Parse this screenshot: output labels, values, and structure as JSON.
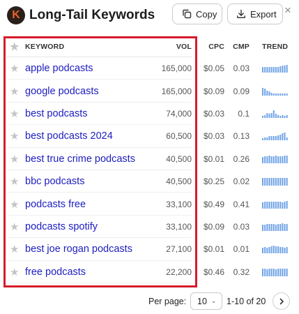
{
  "header": {
    "logo_letter": "K",
    "title": "Long-Tail Keywords",
    "copy_label": "Copy",
    "export_label": "Export",
    "close_glyph": "×"
  },
  "table": {
    "columns": {
      "keyword": "KEYWORD",
      "vol": "VOL",
      "cpc": "CPC",
      "cmp": "CMP",
      "trend": "TREND"
    },
    "rows": [
      {
        "keyword": "apple podcasts",
        "vol": "165,000",
        "cpc": "$0.05",
        "cmp": "0.03",
        "trend": [
          7,
          7,
          7,
          7,
          7,
          7,
          7,
          7,
          8,
          9,
          9,
          10
        ]
      },
      {
        "keyword": "google podcasts",
        "vol": "165,000",
        "cpc": "$0.09",
        "cmp": "0.09",
        "trend": [
          10,
          9,
          6,
          5,
          4,
          3,
          3,
          3,
          3,
          3,
          3,
          3
        ]
      },
      {
        "keyword": "best podcasts",
        "vol": "74,000",
        "cpc": "$0.03",
        "cmp": "0.1",
        "trend": [
          3,
          4,
          6,
          5,
          6,
          10,
          5,
          4,
          3,
          4,
          3,
          4
        ]
      },
      {
        "keyword": "best podcasts 2024",
        "vol": "60,500",
        "cpc": "$0.03",
        "cmp": "0.13",
        "trend": [
          3,
          4,
          4,
          5,
          5,
          5,
          5,
          6,
          7,
          9,
          10,
          4
        ]
      },
      {
        "keyword": "best true crime podcasts",
        "vol": "40,500",
        "cpc": "$0.01",
        "cmp": "0.26",
        "trend": [
          7,
          8,
          8,
          9,
          8,
          8,
          9,
          8,
          8,
          8,
          9,
          9
        ]
      },
      {
        "keyword": "bbc podcasts",
        "vol": "40,500",
        "cpc": "$0.25",
        "cmp": "0.02",
        "trend": [
          10,
          10,
          10,
          10,
          10,
          10,
          10,
          10,
          10,
          10,
          10,
          10
        ]
      },
      {
        "keyword": "podcasts free",
        "vol": "33,100",
        "cpc": "$0.49",
        "cmp": "0.41",
        "trend": [
          8,
          9,
          9,
          9,
          9,
          9,
          9,
          9,
          9,
          8,
          9,
          10
        ]
      },
      {
        "keyword": "podcasts spotify",
        "vol": "33,100",
        "cpc": "$0.09",
        "cmp": "0.03",
        "trend": [
          7,
          7,
          8,
          8,
          8,
          8,
          7,
          8,
          8,
          9,
          8,
          8
        ]
      },
      {
        "keyword": "best joe rogan podcasts",
        "vol": "27,100",
        "cpc": "$0.01",
        "cmp": "0.01",
        "trend": [
          7,
          8,
          7,
          8,
          9,
          10,
          9,
          9,
          8,
          8,
          7,
          8
        ]
      },
      {
        "keyword": "free podcasts",
        "vol": "22,200",
        "cpc": "$0.46",
        "cmp": "0.32",
        "trend": [
          9,
          9,
          8,
          9,
          9,
          9,
          8,
          9,
          9,
          9,
          9,
          9
        ]
      }
    ]
  },
  "footer": {
    "per_page_label": "Per page:",
    "per_page_value": "10",
    "range": "1-10 of 20"
  },
  "colors": {
    "keyword_link": "#1d1dc0",
    "trend_bar": "#6fa3e6",
    "highlight_border": "#d61c2b",
    "logo_bg": "#2b1f1a",
    "logo_letter": "#e8622c"
  }
}
